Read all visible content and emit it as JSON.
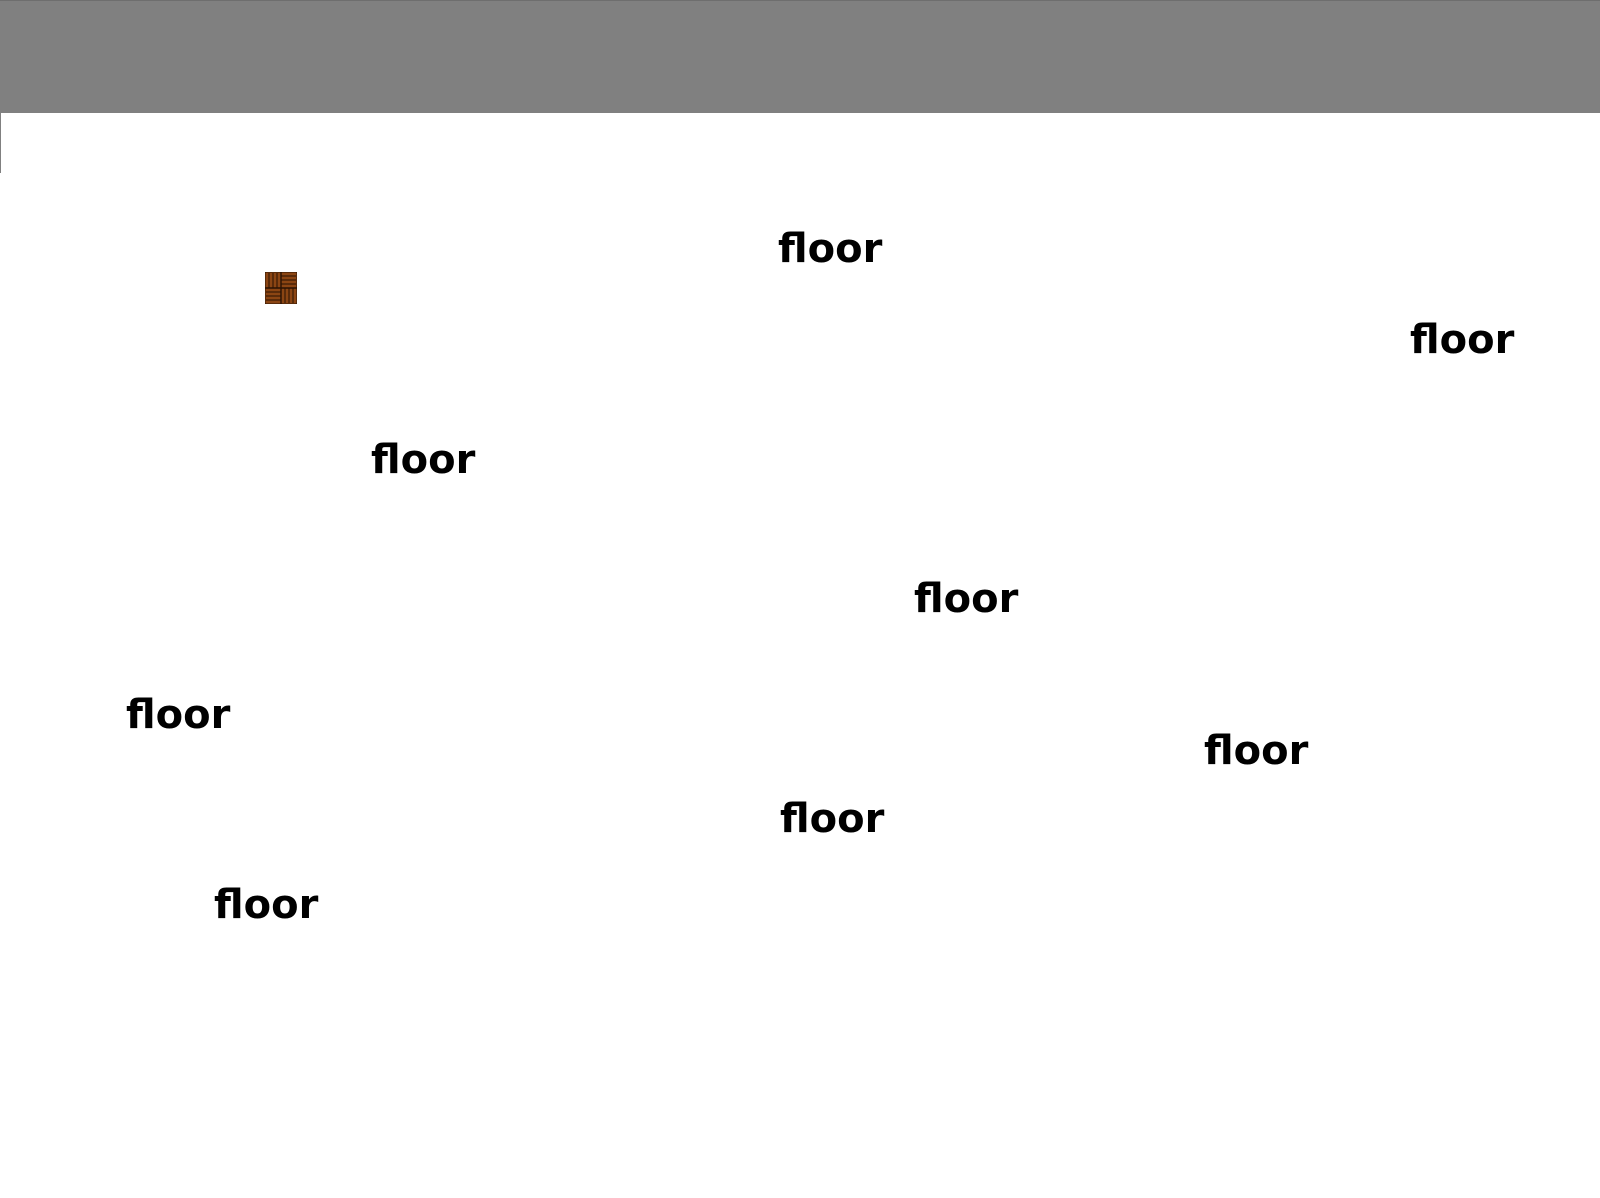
{
  "colors": {
    "top_bar": "#808080",
    "background": "#ffffff",
    "label_text": "#000000",
    "tile_wood": "#8b4513",
    "tile_grain": "#3b1a05"
  },
  "palette": {
    "selected_tile": {
      "icon": "parquet-floor-tile-icon"
    }
  },
  "canvas": {
    "labels": [
      {
        "text": "floor"
      },
      {
        "text": "floor"
      },
      {
        "text": "floor"
      },
      {
        "text": "floor"
      },
      {
        "text": "floor"
      },
      {
        "text": "floor"
      },
      {
        "text": "floor"
      },
      {
        "text": "floor"
      }
    ]
  }
}
